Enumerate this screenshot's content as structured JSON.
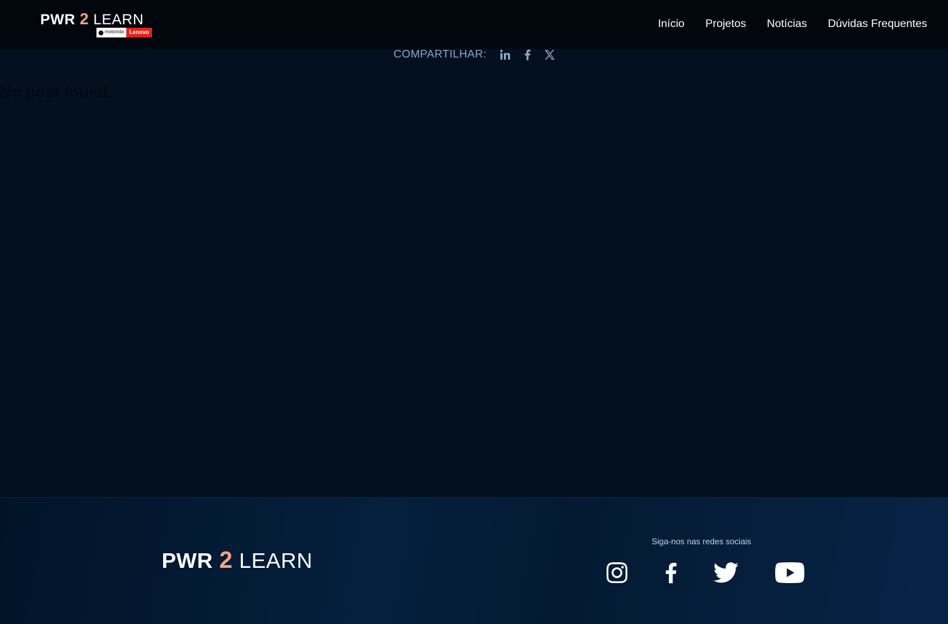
{
  "header": {
    "logo": {
      "pwr": "PWR",
      "two": "2",
      "learn": "LEARN",
      "sponsor_motorola": "motorola",
      "sponsor_lenovo": "Lenovo"
    },
    "nav": [
      {
        "label": "Início"
      },
      {
        "label": "Projetos"
      },
      {
        "label": "Notícias"
      },
      {
        "label": "Dúvidas Frequentes"
      }
    ]
  },
  "share": {
    "label": "COMPARTILHAR:",
    "icons": [
      "linkedin-icon",
      "facebook-icon",
      "x-icon"
    ]
  },
  "main": {
    "message": "No post found."
  },
  "footer": {
    "logo": {
      "pwr": "PWR",
      "two": "2",
      "learn": "LEARN"
    },
    "follow_label": "Siga-nos nas redes sociais",
    "social_icons": [
      "instagram-icon",
      "facebook-icon",
      "twitter-icon",
      "youtube-icon"
    ]
  },
  "colors": {
    "background": "#02101f",
    "header_bg": "#02070e",
    "accent": "#f4a57e",
    "share_text": "#8fa5c4",
    "lenovo_red": "#e2231a"
  }
}
